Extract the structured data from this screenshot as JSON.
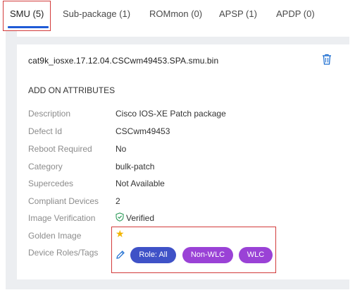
{
  "tabs": [
    {
      "label": "SMU (5)"
    },
    {
      "label": "Sub-package (1)"
    },
    {
      "label": "ROMmon (0)"
    },
    {
      "label": "APSP (1)"
    },
    {
      "label": "APDP (0)"
    }
  ],
  "card": {
    "file_name": "cat9k_iosxe.17.12.04.CSCwm49453.SPA.smu.bin",
    "section_title": "ADD ON ATTRIBUTES",
    "attributes": {
      "description": {
        "label": "Description",
        "value": "Cisco IOS-XE Patch package"
      },
      "defect_id": {
        "label": "Defect Id",
        "value": "CSCwm49453"
      },
      "reboot_required": {
        "label": "Reboot Required",
        "value": "No"
      },
      "category": {
        "label": "Category",
        "value": "bulk-patch"
      },
      "supercedes": {
        "label": "Supercedes",
        "value": "Not Available"
      },
      "compliant_devices": {
        "label": "Compliant Devices",
        "value": "2"
      },
      "image_verification": {
        "label": "Image Verification",
        "value": "Verified"
      },
      "golden_image": {
        "label": "Golden Image"
      },
      "device_roles_tags": {
        "label": "Device Roles/Tags"
      }
    },
    "tags": [
      {
        "label": "Role: All"
      },
      {
        "label": "Non-WLC"
      },
      {
        "label": "WLC"
      }
    ]
  },
  "colors": {
    "active_tab_underline": "#1f5bd6",
    "annotation_box": "#d23b3b",
    "role_pill": "#3f52c7",
    "tag_pill": "#9a42d6",
    "verified": "#2e9c5a",
    "golden_star": "#f2b400"
  },
  "icons": {
    "delete": "trash-icon",
    "verified": "shield-check-icon",
    "golden": "star-icon",
    "edit": "pencil-icon"
  }
}
